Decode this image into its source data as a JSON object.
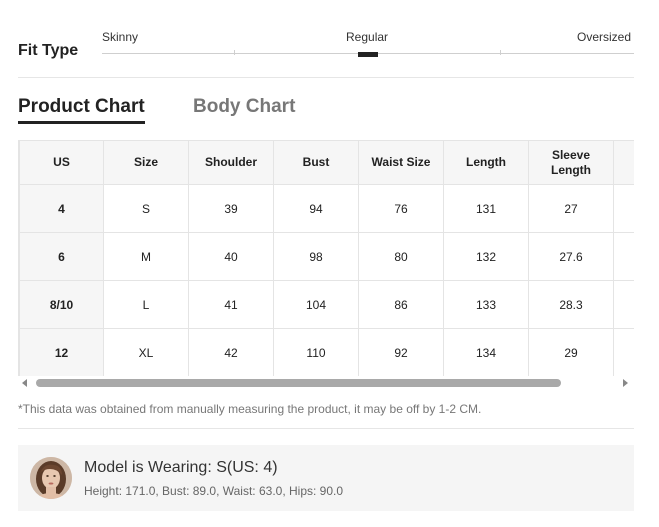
{
  "fit_type": {
    "title": "Fit Type",
    "options": [
      "Skinny",
      "Regular",
      "Oversized"
    ],
    "selected": "Regular"
  },
  "tabs": {
    "product": "Product Chart",
    "body": "Body Chart",
    "active": "Product Chart"
  },
  "size_table": {
    "headers": [
      "US",
      "Size",
      "Shoulder",
      "Bust",
      "Waist Size",
      "Length",
      "Sleeve Length"
    ],
    "rows": [
      [
        "4",
        "S",
        "39",
        "94",
        "76",
        "131",
        "27"
      ],
      [
        "6",
        "M",
        "40",
        "98",
        "80",
        "132",
        "27.6"
      ],
      [
        "8/10",
        "L",
        "41",
        "104",
        "86",
        "133",
        "28.3"
      ],
      [
        "12",
        "XL",
        "42",
        "110",
        "92",
        "134",
        "29"
      ]
    ]
  },
  "note": "*This data was obtained from manually measuring the product, it may be off by 1-2 CM.",
  "model": {
    "title": "Model is Wearing: S(US: 4)",
    "details": "Height: 171.0, Bust: 89.0, Waist: 63.0, Hips: 90.0"
  },
  "colors": {
    "text": "#222222",
    "muted": "#777777",
    "header_bg": "#f6f6f6",
    "border": "#e4e4e4",
    "card_bg": "#f5f5f5"
  }
}
